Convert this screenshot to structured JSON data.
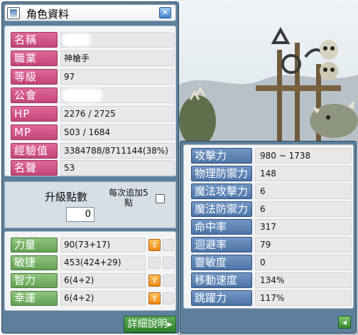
{
  "window": {
    "title": "角色資料",
    "close_glyph": "✕"
  },
  "info": [
    {
      "label": "名稱",
      "value": ""
    },
    {
      "label": "職業",
      "value": "神槍手"
    },
    {
      "label": "等級",
      "value": "97"
    },
    {
      "label": "公會",
      "value": ""
    },
    {
      "label": "HP",
      "value": "2276 / 2725"
    },
    {
      "label": "MP",
      "value": "503 / 1684"
    },
    {
      "label": "經驗值",
      "value": "3384788/8711144(38%)"
    },
    {
      "label": "名聲",
      "value": "53"
    }
  ],
  "ability_points": {
    "label": "升級點數",
    "value": "0",
    "auto_assign_label": "每次追加5點",
    "auto_assign_checked": false
  },
  "stats": [
    {
      "label": "力量",
      "value": "90(73+17)",
      "can_raise": true
    },
    {
      "label": "敏捷",
      "value": "453(424+29)",
      "can_raise": false
    },
    {
      "label": "智力",
      "value": "6(4+2)",
      "can_raise": true
    },
    {
      "label": "幸運",
      "value": "6(4+2)",
      "can_raise": true
    }
  ],
  "detail_button": "詳細說明▸",
  "details": [
    {
      "label": "攻擊力",
      "value": "980 ~ 1738"
    },
    {
      "label": "物理防禦力",
      "value": "148"
    },
    {
      "label": "魔法攻擊力",
      "value": "6"
    },
    {
      "label": "魔法防禦力",
      "value": "6"
    },
    {
      "label": "命中率",
      "value": "317"
    },
    {
      "label": "迴避率",
      "value": "79"
    },
    {
      "label": "靈敏度",
      "value": "0"
    },
    {
      "label": "移動速度",
      "value": "134%"
    },
    {
      "label": "跳躍力",
      "value": "117%"
    }
  ],
  "icons": {
    "up": "⇧",
    "back": "◂"
  },
  "colors": {
    "window_frame": "#5d7f9b",
    "info_label": "#c34677",
    "stat_label": "#64a154",
    "detail_label": "#4d74a7",
    "raise_button": "#f08a16"
  }
}
